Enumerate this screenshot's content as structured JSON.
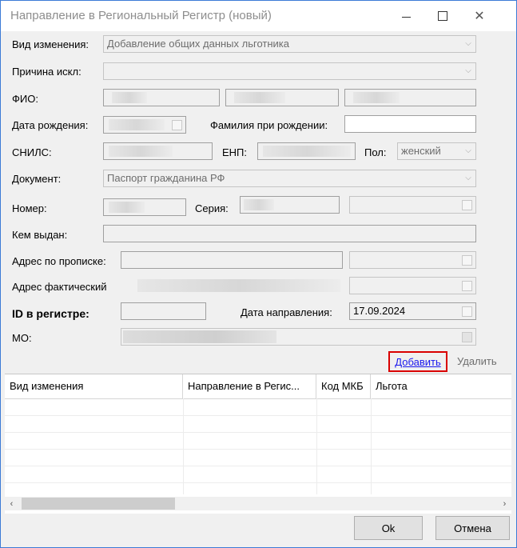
{
  "window": {
    "title": "Направление в Региональный Регистр (новый)"
  },
  "labels": {
    "change_type": "Вид изменения:",
    "reason": "Причина искл:",
    "fio": "ФИО:",
    "birth_date": "Дата рождения:",
    "birth_surname": "Фамилия при рождении:",
    "snils": "СНИЛС:",
    "enp": "ЕНП:",
    "gender": "Пол:",
    "document": "Документ:",
    "number": "Номер:",
    "series": "Серия:",
    "issued_by": "Кем выдан:",
    "reg_address": "Адрес по прописке:",
    "actual_address": "Адрес фактический",
    "registry_id": "ID в регистре:",
    "referral_date": "Дата направления:",
    "mo": "МО:"
  },
  "values": {
    "change_type": "Добавление общих данных льготника",
    "reason": "",
    "birth_surname": "",
    "gender": "женский",
    "document": "Паспорт гражданина РФ",
    "issued_by": "",
    "registry_id": "",
    "referral_date": "17.09.2024"
  },
  "actions": {
    "add": "Добавить",
    "delete": "Удалить",
    "ok": "Ok",
    "cancel": "Отмена"
  },
  "grid": {
    "columns": [
      "Вид изменения",
      "Направление в Регис...",
      "Код МКБ",
      "Льгота"
    ],
    "rows": []
  },
  "colors": {
    "highlight_border": "#d90000",
    "link": "#1a1aee",
    "window_border": "#3c7bd6"
  }
}
